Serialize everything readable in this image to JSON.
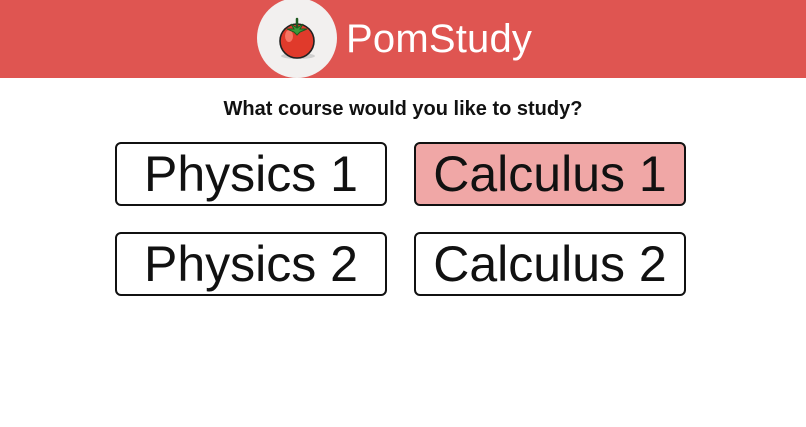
{
  "header": {
    "brand": "PomStudy",
    "logo_icon": "tomato-icon",
    "background_color": "#df5551"
  },
  "main": {
    "question": "What course would you like to study?",
    "courses": [
      {
        "label": "Physics 1",
        "selected": false
      },
      {
        "label": "Calculus 1",
        "selected": true
      },
      {
        "label": "Physics 2",
        "selected": false
      },
      {
        "label": "Calculus 2",
        "selected": false
      }
    ],
    "selected_color": "#f0a7a6"
  }
}
